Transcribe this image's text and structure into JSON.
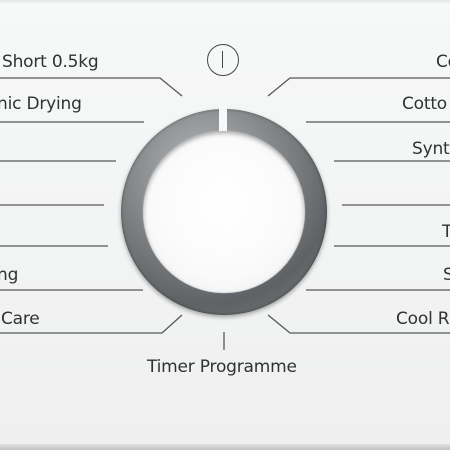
{
  "panel": {
    "left_programs": [
      "Short 0.5kg",
      "nic Drying",
      "ng",
      " Care"
    ],
    "right_programs": [
      "Co",
      "Cotto",
      "Synt",
      "T",
      "S",
      "Cool R"
    ],
    "bottom_program": "Timer Programme",
    "power_icon": "power-icon",
    "selector_dial": "program-selector-knob"
  }
}
